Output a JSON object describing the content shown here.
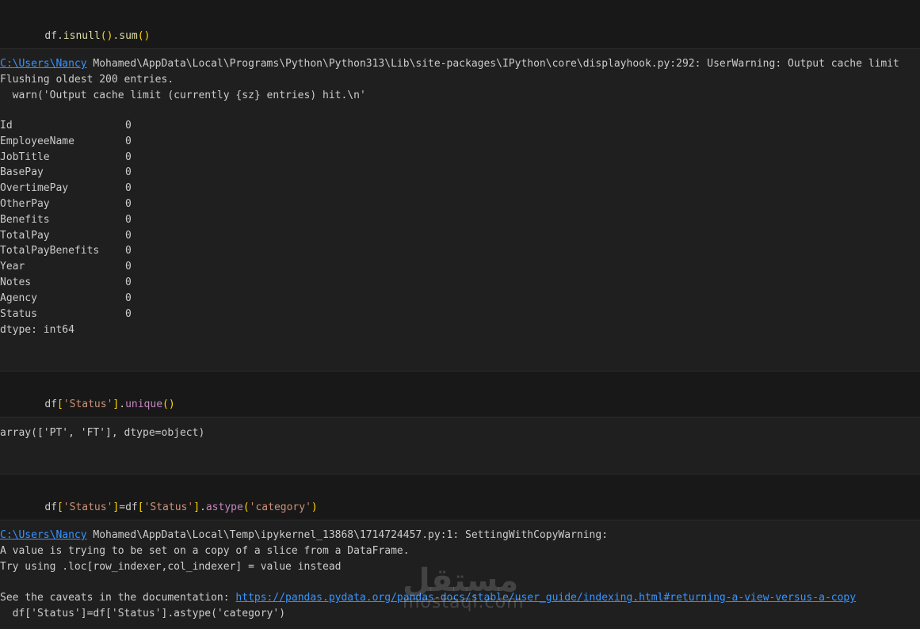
{
  "cells": {
    "c1": {
      "code": {
        "obj": "df",
        "dot1": ".",
        "fn1": "isnull",
        "p1o": "(",
        "p1c": ")",
        "dot2": ".",
        "fn2": "sum",
        "p2o": "(",
        "p2c": ")"
      }
    },
    "o1": {
      "warn_path_link": "C:\\Users\\Nancy",
      "warn_rest": " Mohamed\\AppData\\Local\\Programs\\Python\\Python313\\Lib\\site-packages\\IPython\\core\\displayhook.py:292: UserWarning: Output cache limit",
      "warn_line2": "Flushing oldest 200 entries.",
      "warn_line3": "  warn('Output cache limit (currently {sz} entries) hit.\\n'",
      "series": [
        {
          "name": "Id",
          "value": "0"
        },
        {
          "name": "EmployeeName",
          "value": "0"
        },
        {
          "name": "JobTitle",
          "value": "0"
        },
        {
          "name": "BasePay",
          "value": "0"
        },
        {
          "name": "OvertimePay",
          "value": "0"
        },
        {
          "name": "OtherPay",
          "value": "0"
        },
        {
          "name": "Benefits",
          "value": "0"
        },
        {
          "name": "TotalPay",
          "value": "0"
        },
        {
          "name": "TotalPayBenefits",
          "value": "0"
        },
        {
          "name": "Year",
          "value": "0"
        },
        {
          "name": "Notes",
          "value": "0"
        },
        {
          "name": "Agency",
          "value": "0"
        },
        {
          "name": "Status",
          "value": "0"
        }
      ],
      "dtype": "dtype: int64"
    },
    "c2": {
      "code": {
        "obj": "df",
        "bo": "[",
        "str": "'Status'",
        "bc": "]",
        "dot": ".",
        "fn": "unique",
        "po": "(",
        "pc": ")"
      }
    },
    "o2": {
      "text": "array(['PT', 'FT'], dtype=object)"
    },
    "c3": {
      "code": {
        "obj": "df",
        "bo": "[",
        "str": "'Status'",
        "bc": "]",
        "eq": "=",
        "obj2": "df",
        "bo2": "[",
        "str2": "'Status'",
        "bc2": "]",
        "dot": ".",
        "fn": "astype",
        "po": "(",
        "str3": "'category'",
        "pc": ")"
      }
    },
    "o3": {
      "warn_path_link": "C:\\Users\\Nancy",
      "warn_rest": " Mohamed\\AppData\\Local\\Temp\\ipykernel_13868\\1714724457.py:1: SettingWithCopyWarning:",
      "line2": "A value is trying to be set on a copy of a slice from a DataFrame.",
      "line3": "Try using .loc[row_indexer,col_indexer] = value instead",
      "line4_prefix": "See the caveats in the documentation: ",
      "line4_link": "https://pandas.pydata.org/pandas-docs/stable/user_guide/indexing.html#returning-a-view-versus-a-copy",
      "line5": "  df['Status']=df['Status'].astype('category')"
    }
  },
  "watermark": {
    "arabic": "مستقل",
    "latin": "mostaql.com"
  }
}
